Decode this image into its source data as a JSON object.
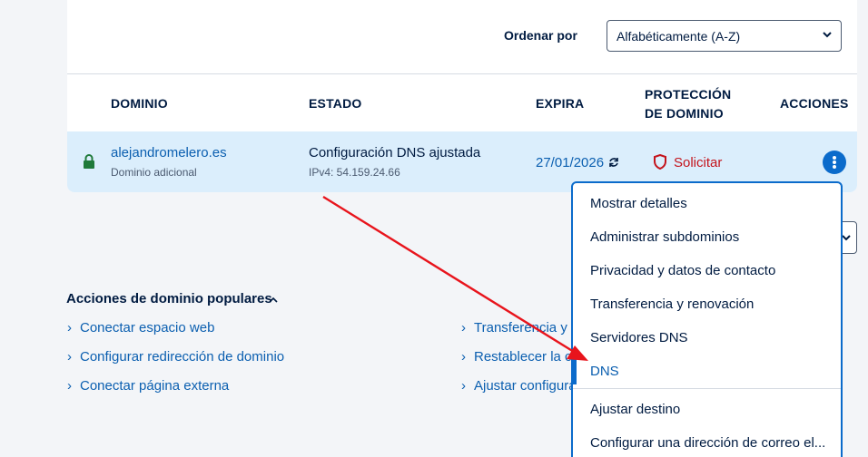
{
  "sort": {
    "label": "Ordenar por",
    "value": "Alfabéticamente (A-Z)"
  },
  "table": {
    "headers": {
      "domain": "DOMINIO",
      "status": "ESTADO",
      "expires": "EXPIRA",
      "protection_line1": "PROTECCIÓN",
      "protection_line2": "DE DOMINIO",
      "actions": "ACCIONES"
    },
    "rows": [
      {
        "domain": "alejandromelero.es",
        "domain_type": "Dominio adicional",
        "status": "Configuración DNS ajustada",
        "status_detail": "IPv4: 54.159.24.66",
        "expires": "27/01/2026",
        "protection_action": "Solicitar"
      }
    ]
  },
  "popular": {
    "title": "Acciones de dominio populares",
    "left_links": [
      "Conectar espacio web",
      "Configurar redirección de dominio",
      "Conectar página externa"
    ],
    "right_links": [
      "Transferencia y r",
      "Restablecer la co",
      "Ajustar configura"
    ]
  },
  "menu": {
    "items": [
      "Mostrar detalles",
      "Administrar subdominios",
      "Privacidad y datos de contacto",
      "Transferencia y renovación",
      "Servidores DNS",
      "DNS",
      "Ajustar destino",
      "Configurar una dirección de correo el..."
    ],
    "active_item": "DNS"
  },
  "colors": {
    "accent": "#0b6bcb",
    "link": "#0b5fb0",
    "danger": "#c4141c",
    "row_highlight": "#dbeefc",
    "annotation_arrow": "#e8141c"
  },
  "icons": [
    "lock-icon",
    "renew-icon",
    "shield-icon",
    "more-vertical-icon",
    "chevron-down-icon",
    "chevron-up-icon",
    "chevron-right-icon"
  ]
}
